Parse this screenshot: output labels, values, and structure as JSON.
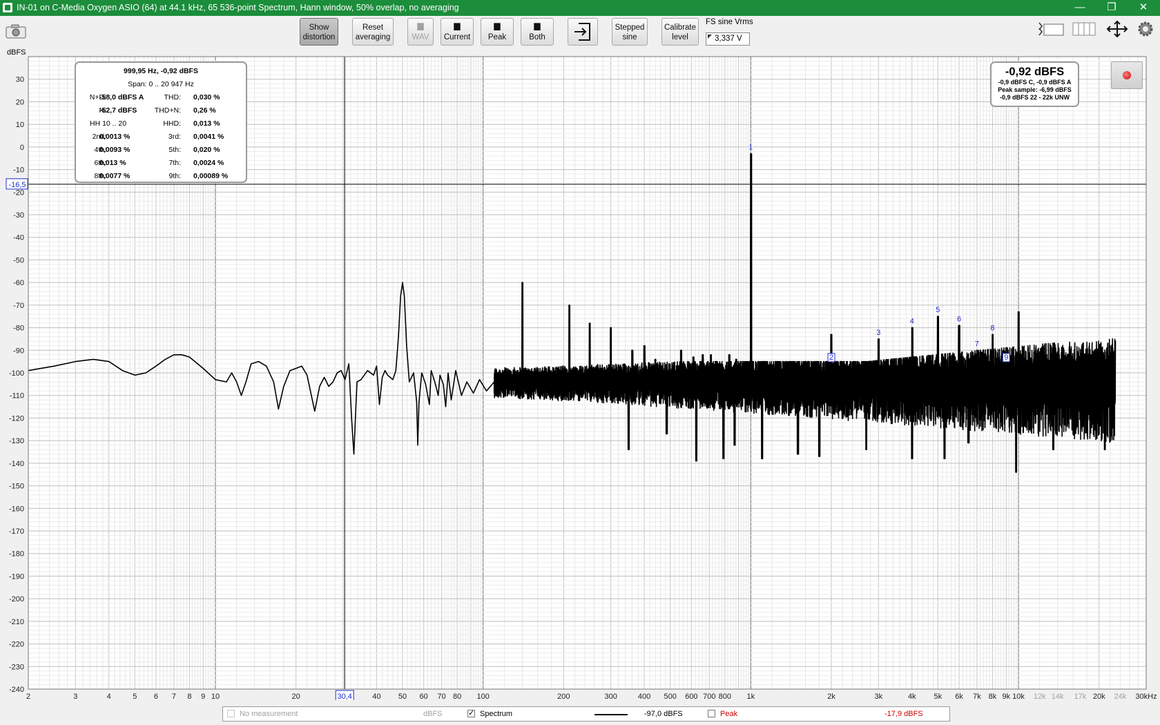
{
  "window": {
    "title": "IN-01 on C-Media Oxygen ASIO (64) at 44.1 kHz, 65 536-point Spectrum, Hann window, 50% overlap, no averaging",
    "controls": {
      "minimize": "—",
      "restore": "❐",
      "close": "✕"
    }
  },
  "toolbar": {
    "show_distortion": {
      "line1": "Show",
      "line2": "distortion"
    },
    "reset_averaging": {
      "line1": "Reset",
      "line2": "averaging"
    },
    "wav": "WAV",
    "current": "Current",
    "peak": "Peak",
    "both": "Both",
    "stepped_sine": {
      "line1": "Stepped",
      "line2": "sine"
    },
    "calibrate_level": {
      "line1": "Calibrate",
      "line2": "level"
    },
    "fs_label": "FS sine Vrms",
    "fs_value": "3,337 V"
  },
  "stats": {
    "header": "999,95 Hz, -0,92 dBFS",
    "span": "Span:  0 .. 20 947 Hz",
    "rows": [
      [
        "N+D:",
        "-58,0 dBFS A",
        "THD:",
        "0,030 %"
      ],
      [
        "N:",
        "-52,7 dBFS",
        "THD+N:",
        "0,26 %"
      ],
      [
        "HH 10 .. 20",
        "",
        "HHD:",
        "0,013 %"
      ],
      [
        "2nd:",
        "0,0013 %",
        "3rd:",
        "0,0041 %"
      ],
      [
        "4th:",
        "0,0093 %",
        "5th:",
        "0,020 %"
      ],
      [
        "6th:",
        "0,013 %",
        "7th:",
        "0,0024 %"
      ],
      [
        "8th:",
        "0,0077 %",
        "9th:",
        "0,00089 %"
      ]
    ]
  },
  "level_meter": {
    "main": "-0,92 dBFS",
    "line1": "-0,9 dBFS C, -0,9 dBFS A",
    "line2": "Peak sample: -6,99 dBFS",
    "line3": "-0,9 dBFS 22 - 22k UNW"
  },
  "cursor": {
    "x_label": "30,4",
    "y_label": "-16,5",
    "x_value": 30.4,
    "y_value": -16.5
  },
  "legend": {
    "no_measurement": "No measurement",
    "unit": "dBFS",
    "spectrum": "Spectrum",
    "spectrum_value": "-97,0 dBFS",
    "peak": "Peak",
    "peak_value": "-17,9 dBFS"
  },
  "colors": {
    "title_bar": "#1b8d3b",
    "spectrum": "#000000",
    "peak": "#cc0000",
    "harmonic_markers": "#1f2fd0"
  },
  "chart_data": {
    "type": "line",
    "ylabel": "dBFS",
    "x_scale": "log",
    "xlim": [
      2,
      30000
    ],
    "ylim": [
      -240,
      40
    ],
    "grid": true,
    "x_tick_labels": [
      {
        "v": 2,
        "t": "2"
      },
      {
        "v": 3,
        "t": "3"
      },
      {
        "v": 4,
        "t": "4"
      },
      {
        "v": 5,
        "t": "5"
      },
      {
        "v": 6,
        "t": "6"
      },
      {
        "v": 7,
        "t": "7"
      },
      {
        "v": 8,
        "t": "8"
      },
      {
        "v": 9,
        "t": "9"
      },
      {
        "v": 10,
        "t": "10"
      },
      {
        "v": 20,
        "t": "20"
      },
      {
        "v": 40,
        "t": "40"
      },
      {
        "v": 50,
        "t": "50"
      },
      {
        "v": 60,
        "t": "60"
      },
      {
        "v": 70,
        "t": "70"
      },
      {
        "v": 80,
        "t": "80"
      },
      {
        "v": 100,
        "t": "100"
      },
      {
        "v": 200,
        "t": "200"
      },
      {
        "v": 300,
        "t": "300"
      },
      {
        "v": 400,
        "t": "400"
      },
      {
        "v": 500,
        "t": "500"
      },
      {
        "v": 600,
        "t": "600"
      },
      {
        "v": 700,
        "t": "700"
      },
      {
        "v": 800,
        "t": "800"
      },
      {
        "v": 1000,
        "t": "1k"
      },
      {
        "v": 2000,
        "t": "2k"
      },
      {
        "v": 3000,
        "t": "3k"
      },
      {
        "v": 4000,
        "t": "4k"
      },
      {
        "v": 5000,
        "t": "5k"
      },
      {
        "v": 6000,
        "t": "6k"
      },
      {
        "v": 7000,
        "t": "7k"
      },
      {
        "v": 8000,
        "t": "8k"
      },
      {
        "v": 9000,
        "t": "9k"
      },
      {
        "v": 10000,
        "t": "10k"
      },
      {
        "v": 12000,
        "t": "12k",
        "grey": true
      },
      {
        "v": 14000,
        "t": "14k",
        "grey": true
      },
      {
        "v": 17000,
        "t": "17k",
        "grey": true
      },
      {
        "v": 20000,
        "t": "20k"
      },
      {
        "v": 24000,
        "t": "24k",
        "grey": true
      },
      {
        "v": 30000,
        "t": "30kHz"
      }
    ],
    "y_ticks": [
      30,
      20,
      10,
      0,
      -10,
      -20,
      -30,
      -40,
      -50,
      -60,
      -70,
      -80,
      -90,
      -100,
      -110,
      -120,
      -130,
      -140,
      -150,
      -160,
      -170,
      -180,
      -190,
      -200,
      -210,
      -220,
      -230,
      -240
    ],
    "series": [
      {
        "name": "Spectrum",
        "lowband": [
          [
            2,
            -99
          ],
          [
            2.5,
            -97
          ],
          [
            3,
            -95
          ],
          [
            3.5,
            -94
          ],
          [
            4,
            -95
          ],
          [
            4.5,
            -99
          ],
          [
            5,
            -101
          ],
          [
            5.5,
            -100
          ],
          [
            6,
            -97
          ],
          [
            6.5,
            -94
          ],
          [
            7,
            -92
          ],
          [
            7.5,
            -92
          ],
          [
            8,
            -93
          ],
          [
            9,
            -98
          ],
          [
            10,
            -103
          ],
          [
            11,
            -104
          ],
          [
            11.5,
            -100
          ],
          [
            12,
            -104
          ],
          [
            12.5,
            -110
          ],
          [
            13,
            -104
          ],
          [
            13.6,
            -96
          ],
          [
            14.5,
            -95
          ],
          [
            15.5,
            -97
          ],
          [
            16.5,
            -104
          ],
          [
            17.2,
            -116
          ],
          [
            18,
            -106
          ],
          [
            19,
            -99
          ],
          [
            20,
            -98
          ],
          [
            21,
            -97
          ],
          [
            22,
            -101
          ],
          [
            23.5,
            -117
          ],
          [
            24.5,
            -106
          ],
          [
            25.5,
            -102
          ],
          [
            26.5,
            -106
          ],
          [
            27.5,
            -104
          ],
          [
            28.5,
            -100
          ],
          [
            29.5,
            -99
          ],
          [
            30.5,
            -103
          ],
          [
            31.5,
            -96
          ],
          [
            32.3,
            -121
          ],
          [
            32.9,
            -136
          ],
          [
            33.8,
            -104
          ],
          [
            35,
            -103
          ],
          [
            37,
            -99
          ],
          [
            39,
            -101
          ],
          [
            40,
            -97
          ],
          [
            41,
            -114
          ],
          [
            42,
            -102
          ],
          [
            43,
            -99
          ],
          [
            44,
            -101
          ],
          [
            46,
            -103
          ],
          [
            47.2,
            -99
          ],
          [
            48.3,
            -84
          ],
          [
            49.2,
            -66
          ],
          [
            50,
            -60
          ],
          [
            50.8,
            -66
          ],
          [
            51.8,
            -88
          ],
          [
            53,
            -104
          ],
          [
            55,
            -100
          ],
          [
            56.5,
            -113
          ],
          [
            57,
            -132
          ],
          [
            57.6,
            -113
          ],
          [
            59,
            -100
          ],
          [
            61,
            -105
          ],
          [
            63,
            -114
          ],
          [
            64,
            -99
          ],
          [
            66,
            -104
          ],
          [
            68,
            -110
          ],
          [
            69,
            -101
          ],
          [
            71,
            -105
          ],
          [
            72.5,
            -115
          ],
          [
            74,
            -100
          ],
          [
            76,
            -112
          ],
          [
            79,
            -99
          ],
          [
            83,
            -110
          ],
          [
            87,
            -104
          ],
          [
            92,
            -109
          ],
          [
            97,
            -103
          ],
          [
            103,
            -108
          ],
          [
            110,
            -104
          ]
        ],
        "noise_floor": {
          "from": 110,
          "to": 23000,
          "mid": -103,
          "top_mid": -95,
          "top_high": -84,
          "bottom": -125
        },
        "spikes": [
          [
            140,
            -60
          ],
          [
            210,
            -70
          ],
          [
            250,
            -78
          ],
          [
            300,
            -80
          ],
          [
            360,
            -90
          ],
          [
            400,
            -88
          ],
          [
            440,
            -94
          ],
          [
            495,
            -96
          ],
          [
            550,
            -90
          ],
          [
            610,
            -93
          ],
          [
            660,
            -92
          ],
          [
            710,
            -92
          ],
          [
            760,
            -96
          ],
          [
            830,
            -92
          ],
          [
            880,
            -94
          ],
          [
            1000,
            -3
          ],
          [
            2000,
            -83
          ],
          [
            3000,
            -85
          ],
          [
            4000,
            -80
          ],
          [
            5000,
            -75
          ],
          [
            6000,
            -79
          ],
          [
            7000,
            -90
          ],
          [
            8000,
            -83
          ],
          [
            9000,
            -96
          ],
          [
            10000,
            -73
          ]
        ],
        "dips": [
          [
            350,
            -134
          ],
          [
            485,
            -127
          ],
          [
            625,
            -139
          ],
          [
            790,
            -138
          ],
          [
            870,
            -132
          ],
          [
            1100,
            -138
          ],
          [
            1500,
            -136
          ],
          [
            1800,
            -137
          ],
          [
            2700,
            -134
          ],
          [
            4000,
            -138
          ],
          [
            5300,
            -138
          ],
          [
            6500,
            -131
          ],
          [
            9800,
            -144
          ],
          [
            13500,
            -134
          ],
          [
            21000,
            -134
          ]
        ]
      }
    ],
    "harmonic_markers": [
      {
        "label": "1",
        "x": 1000,
        "y": -3
      },
      {
        "label": "2",
        "x": 2000,
        "y": -96,
        "boxed": true
      },
      {
        "label": "3",
        "x": 3000,
        "y": -85
      },
      {
        "label": "4",
        "x": 4000,
        "y": -80
      },
      {
        "label": "5",
        "x": 5000,
        "y": -75
      },
      {
        "label": "6",
        "x": 6000,
        "y": -79
      },
      {
        "label": "7",
        "x": 7000,
        "y": -90
      },
      {
        "label": "8",
        "x": 8000,
        "y": -83
      },
      {
        "label": "9",
        "x": 9000,
        "y": -96,
        "boxed": true
      }
    ]
  }
}
